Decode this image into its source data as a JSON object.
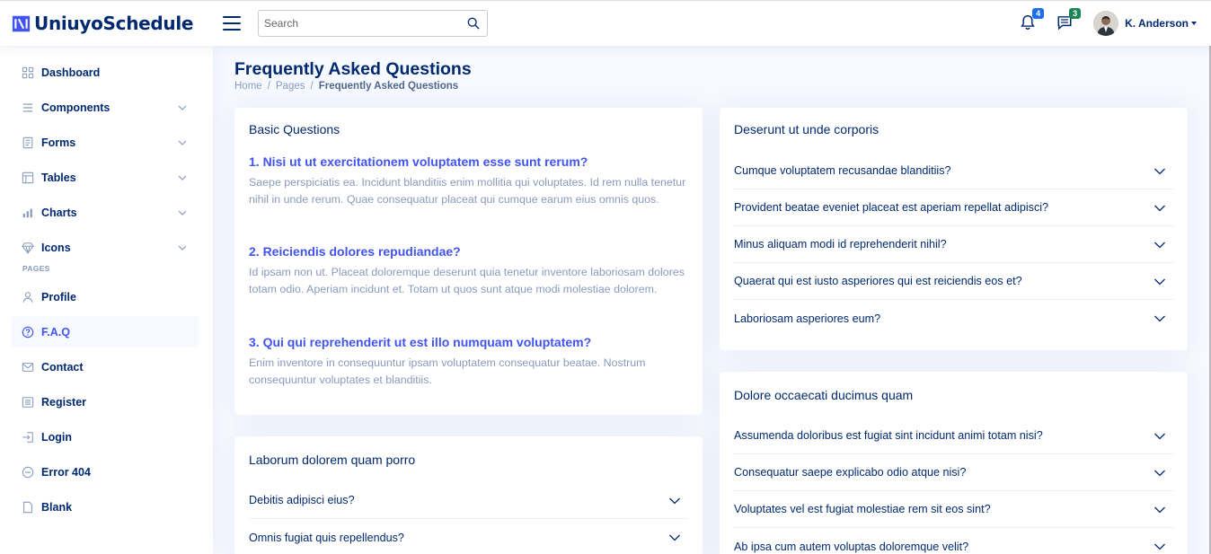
{
  "app": {
    "name": "UniuyoSchedule"
  },
  "header": {
    "search_placeholder": "Search",
    "notifications_count": "4",
    "messages_count": "3",
    "username": "K. Anderson"
  },
  "sidebar": {
    "items": [
      {
        "label": "Dashboard",
        "icon": "grid-icon"
      },
      {
        "label": "Components",
        "icon": "menu-icon"
      },
      {
        "label": "Forms",
        "icon": "journal-icon"
      },
      {
        "label": "Tables",
        "icon": "layout-icon"
      },
      {
        "label": "Charts",
        "icon": "bar-chart-icon"
      },
      {
        "label": "Icons",
        "icon": "gem-icon"
      }
    ],
    "heading": "PAGES",
    "pages": [
      {
        "label": "Profile",
        "icon": "person-icon"
      },
      {
        "label": "F.A.Q",
        "icon": "question-circle-icon"
      },
      {
        "label": "Contact",
        "icon": "envelope-icon"
      },
      {
        "label": "Register",
        "icon": "card-list-icon"
      },
      {
        "label": "Login",
        "icon": "box-arrow-in-icon"
      },
      {
        "label": "Error 404",
        "icon": "dash-circle-icon"
      },
      {
        "label": "Blank",
        "icon": "file-icon"
      }
    ]
  },
  "page": {
    "title": "Frequently Asked Questions",
    "breadcrumb": [
      "Home",
      "Pages",
      "Frequently Asked Questions"
    ]
  },
  "basic": {
    "title": "Basic Questions",
    "items": [
      {
        "q": "1. Nisi ut ut exercitationem voluptatem esse sunt rerum?",
        "a": "Saepe perspiciatis ea. Incidunt blanditiis enim mollitia qui voluptates. Id rem nulla tenetur nihil in unde rerum. Quae consequatur placeat qui cumque earum eius omnis quos."
      },
      {
        "q": "2. Reiciendis dolores repudiandae?",
        "a": "Id ipsam non ut. Placeat doloremque deserunt quia tenetur inventore laboriosam dolores totam odio. Aperiam incidunt et. Totam ut quos sunt atque modi molestiae dolorem."
      },
      {
        "q": "3. Qui qui reprehenderit ut est illo numquam voluptatem?",
        "a": "Enim inventore in consequuntur ipsam voluptatem consequatur beatae. Nostrum consequuntur voluptates et blanditiis."
      }
    ]
  },
  "laborum": {
    "title": "Laborum dolorem quam porro",
    "items": [
      "Debitis adipisci eius?",
      "Omnis fugiat quis repellendus?"
    ]
  },
  "deserunt": {
    "title": "Deserunt ut unde corporis",
    "items": [
      "Cumque voluptatem recusandae blanditiis?",
      "Provident beatae eveniet placeat est aperiam repellat adipisci?",
      "Minus aliquam modi id reprehenderit nihil?",
      "Quaerat qui est iusto asperiores qui est reiciendis eos et?",
      "Laboriosam asperiores eum?"
    ]
  },
  "dolore": {
    "title": "Dolore occaecati ducimus quam",
    "items": [
      "Assumenda doloribus est fugiat sint incidunt animi totam nisi?",
      "Consequatur saepe explicabo odio atque nisi?",
      "Voluptates vel est fugiat molestiae rem sit eos sint?",
      "Ab ipsa cum autem voluptas doloremque velit?"
    ]
  },
  "colors": {
    "navy": "#012970",
    "accent": "#4154f1",
    "muted": "#899bbd",
    "bg": "#f6f9ff"
  }
}
